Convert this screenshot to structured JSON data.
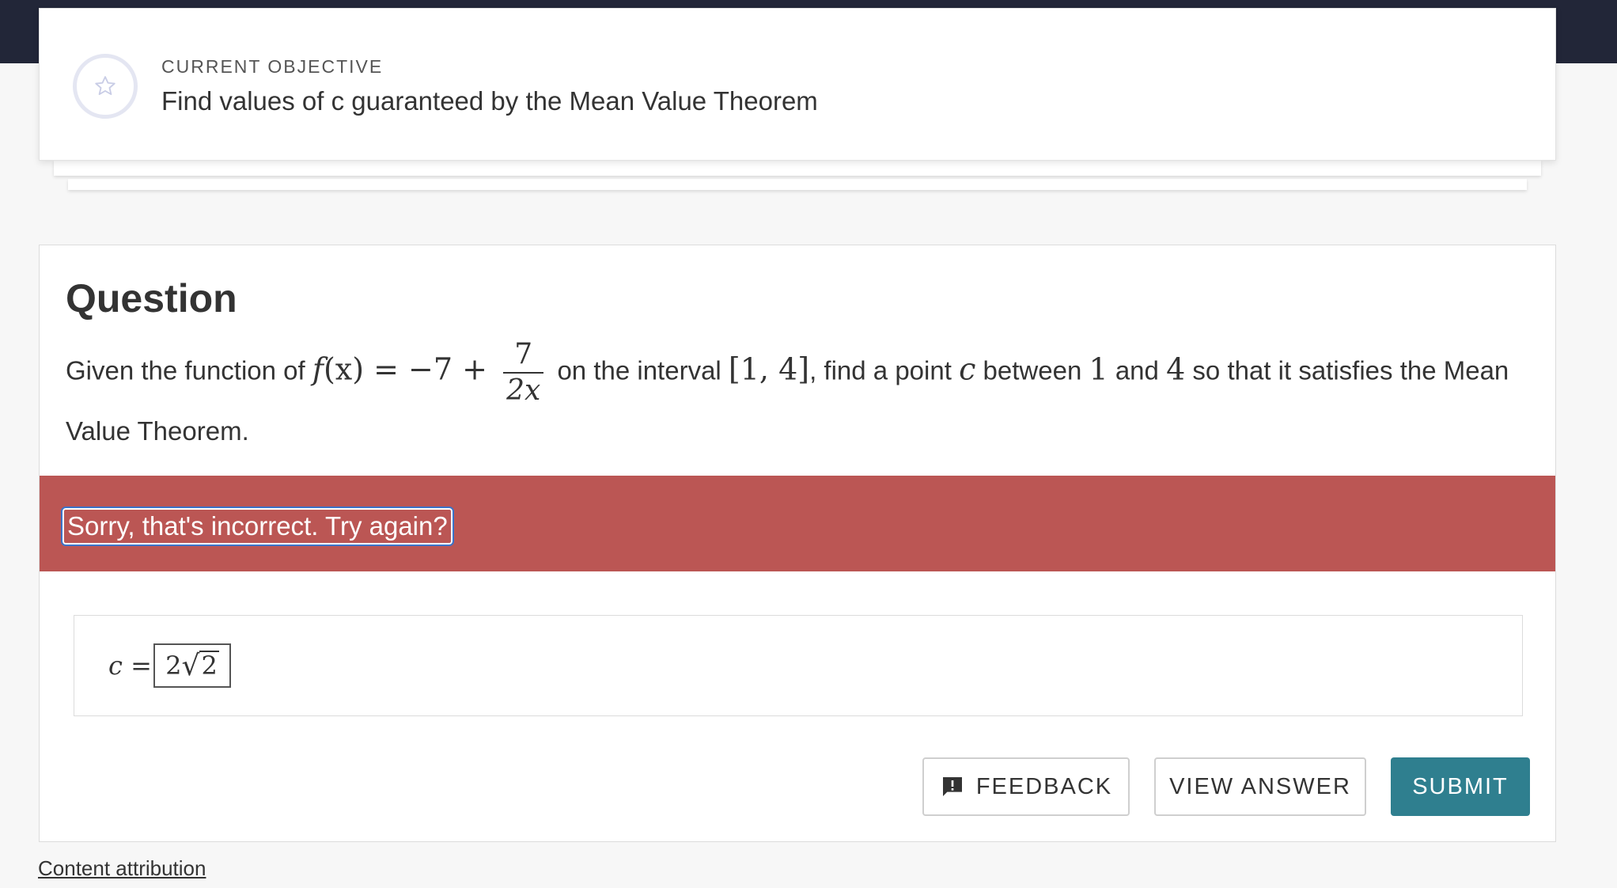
{
  "objective": {
    "label": "CURRENT OBJECTIVE",
    "text": "Find values of c guaranteed by the Mean Value Theorem",
    "icon": "star-icon"
  },
  "question": {
    "title": "Question",
    "text_before": "Given the function of",
    "func_name": "f",
    "func_arg": "(x)",
    "func_mid": " = −7 + ",
    "frac_num": "7",
    "frac_den": "2x",
    "text_interval": " on the interval ",
    "interval": "[1, 4]",
    "text_find": ", find a point ",
    "point": "c",
    "text_between": " between ",
    "low": "1",
    "text_and": " and ",
    "high": "4",
    "text_end": " so that it satisfies the Mean Value Theorem."
  },
  "feedback": {
    "message": "Sorry, that's incorrect. Try again?",
    "color": "#bb5654"
  },
  "answer": {
    "variable": "c =",
    "coef": "2",
    "radicand": "2"
  },
  "actions": {
    "feedback_label": "FEEDBACK",
    "view_answer_label": "VIEW ANSWER",
    "submit_label": "SUBMIT",
    "submit_color": "#2f7f8f"
  },
  "footer": {
    "attribution_label": "Content attribution"
  }
}
